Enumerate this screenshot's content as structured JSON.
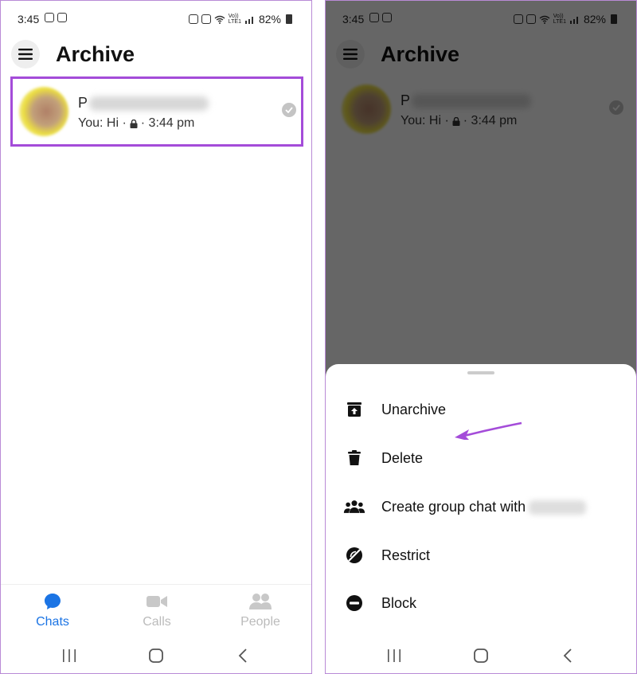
{
  "status_bar": {
    "time": "3:45",
    "battery": "82%",
    "network_top": "Vo))",
    "network_bottom": "LTE1"
  },
  "app_bar": {
    "title": "Archive"
  },
  "chat": {
    "name_initial": "P",
    "preview": "You: Hi ·",
    "time": "· 3:44 pm"
  },
  "tabs": [
    {
      "label": "Chats",
      "icon": "chat-bubble-icon",
      "active": true
    },
    {
      "label": "Calls",
      "icon": "video-camera-icon",
      "active": false
    },
    {
      "label": "People",
      "icon": "people-icon",
      "active": false
    }
  ],
  "sheet": {
    "items": [
      {
        "label": "Unarchive",
        "icon": "unarchive-icon"
      },
      {
        "label": "Delete",
        "icon": "trash-icon"
      },
      {
        "label": "Create group chat with",
        "icon": "group-icon"
      },
      {
        "label": "Restrict",
        "icon": "restrict-icon"
      },
      {
        "label": "Block",
        "icon": "block-icon"
      }
    ]
  },
  "colors": {
    "highlight": "#a44cd9",
    "accent": "#1b74e4",
    "annotation_arrow": "#a44cd9"
  }
}
